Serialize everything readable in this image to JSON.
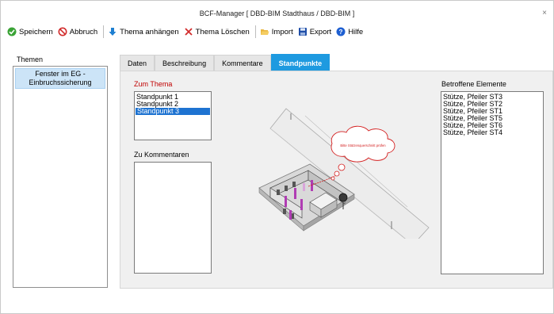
{
  "window": {
    "title": "BCF-Manager [ DBD-BIM Stadthaus  /  DBD-BIM ]",
    "close_glyph": "×"
  },
  "toolbar": {
    "items": [
      {
        "label": "Speichern",
        "icon": "check-circle-icon",
        "color": "#3aa335"
      },
      {
        "label": "Abbruch",
        "icon": "no-entry-icon",
        "color": "#d12b2b"
      },
      {
        "label": "Thema anhängen",
        "icon": "arrow-down-icon",
        "color": "#1e7fd1"
      },
      {
        "label": "Thema Löschen",
        "icon": "delete-x-icon",
        "color": "#d12b2b"
      },
      {
        "label": "Import",
        "icon": "folder-open-icon",
        "color": "#e0a526"
      },
      {
        "label": "Export",
        "icon": "floppy-disk-icon",
        "color": "#1f4ea8"
      },
      {
        "label": "Hilfe",
        "icon": "help-circle-icon",
        "color": "#1e5fd1"
      }
    ]
  },
  "sidebar": {
    "title": "Themen",
    "topics": [
      {
        "line1": "Fenster im EG -",
        "line2": "Einbruchssicherung"
      }
    ]
  },
  "tabs": [
    {
      "label": "Daten",
      "active": false
    },
    {
      "label": "Beschreibung",
      "active": false
    },
    {
      "label": "Kommentare",
      "active": false
    },
    {
      "label": "Standpunkte",
      "active": true
    }
  ],
  "standpunkte": {
    "zum_thema_label": "Zum Thema",
    "viewpoints": [
      "Standpunkt 1",
      "Standpunkt 2",
      "Standpunkt 3"
    ],
    "selected_index": 2,
    "zu_kommentaren_label": "Zu Kommentaren",
    "betroffene_label": "Betroffene Elemente",
    "elements": [
      "Stütze, Pfeiler ST3",
      "Stütze, Pfeiler ST2",
      "Stütze, Pfeiler ST1",
      "Stütze, Pfeiler ST5",
      "Stütze, Pfeiler ST6",
      "Stütze, Pfeiler ST4"
    ],
    "viewport_annotation": "Bitte Stützenquerschnitt prüfen"
  },
  "colors": {
    "accent": "#1e9ae0",
    "selection": "#1e73d1",
    "label_red": "#c00000",
    "annotation_red": "#d41f1f",
    "element_highlight": "#b03cb3"
  }
}
